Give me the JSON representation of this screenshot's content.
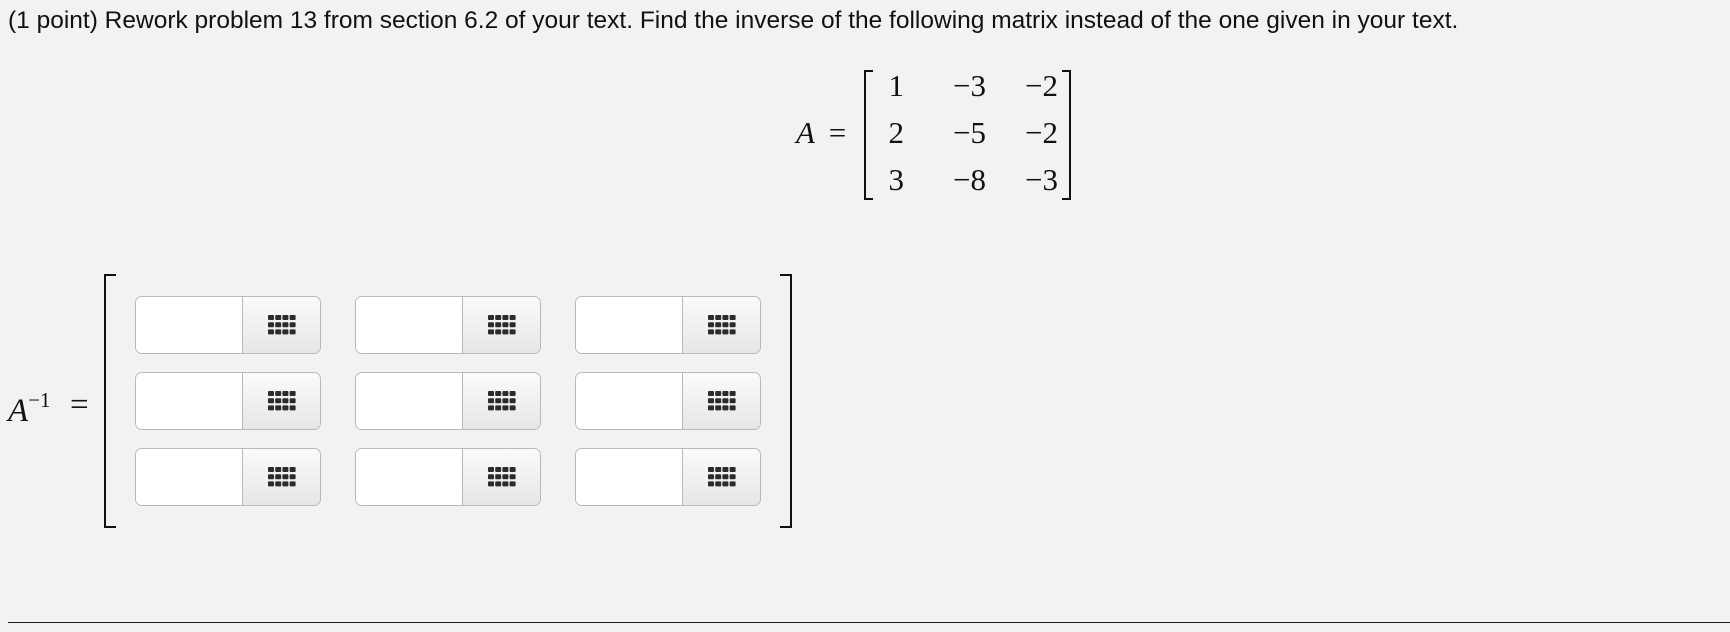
{
  "problem": {
    "text": "(1 point) Rework problem 13 from section 6.2 of your text. Find the inverse of the following matrix instead of the one given in your text."
  },
  "given_matrix": {
    "name": "A",
    "equals": "=",
    "rows": [
      [
        "1",
        "−3",
        "−2"
      ],
      [
        "2",
        "−5",
        "−2"
      ],
      [
        "3",
        "−8",
        "−3"
      ]
    ]
  },
  "answer": {
    "name": "A",
    "exponent": "−1",
    "equals": "=",
    "entries": [
      [
        "",
        "",
        ""
      ],
      [
        "",
        "",
        ""
      ],
      [
        "",
        "",
        ""
      ]
    ],
    "palette_icon": "grid-palette-icon"
  }
}
